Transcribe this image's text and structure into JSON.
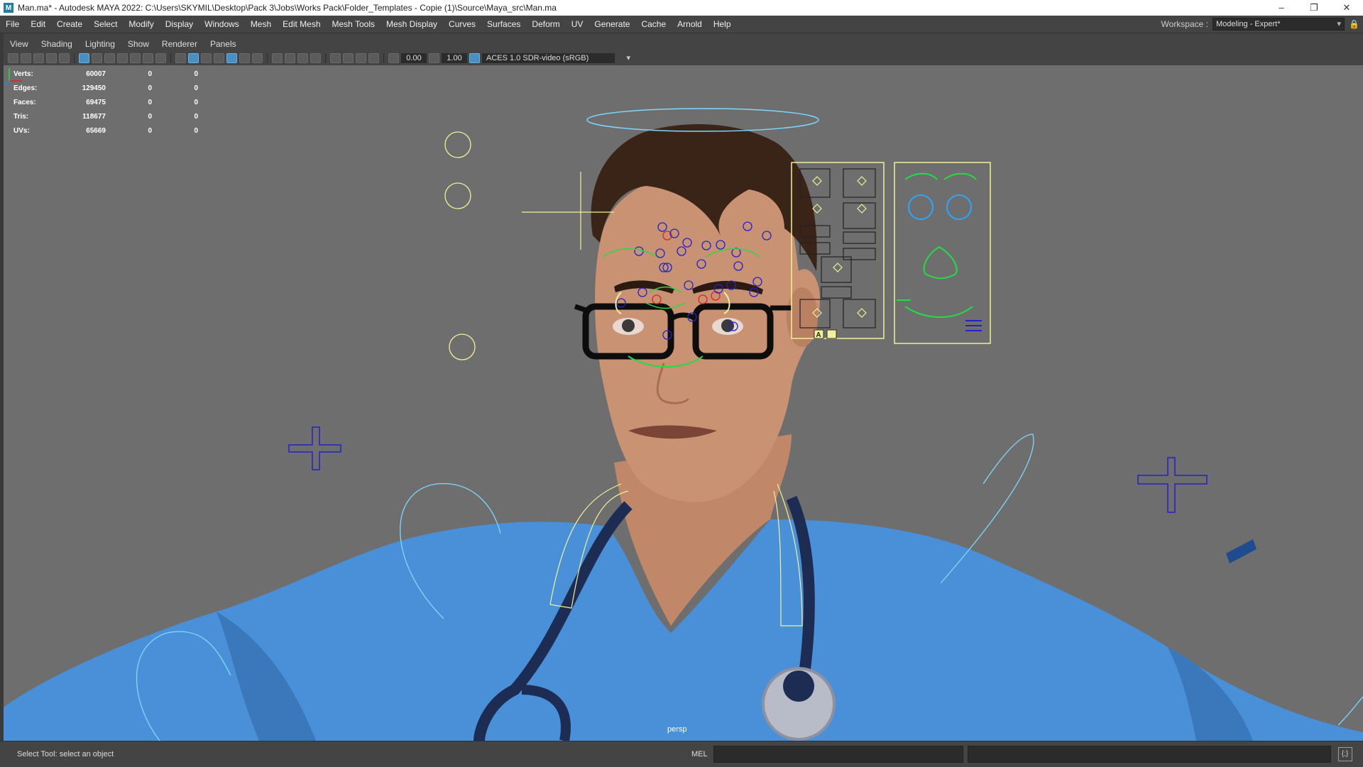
{
  "window": {
    "title": "Man.ma* - Autodesk MAYA 2022: C:\\Users\\SKYMIL\\Desktop\\Pack 3\\Jobs\\Works Pack\\Folder_Templates - Copie (1)\\Source\\Maya_src\\Man.ma",
    "app_icon_letter": "M",
    "minimize": "–",
    "restore": "❐",
    "close": "✕"
  },
  "menubar": {
    "items": [
      "File",
      "Edit",
      "Create",
      "Select",
      "Modify",
      "Display",
      "Windows",
      "Mesh",
      "Edit Mesh",
      "Mesh Tools",
      "Mesh Display",
      "Curves",
      "Surfaces",
      "Deform",
      "UV",
      "Generate",
      "Cache",
      "Arnold",
      "Help"
    ]
  },
  "workspace": {
    "label": "Workspace :",
    "value": "Modeling - Expert*",
    "caret": "▾",
    "lock": "🔒"
  },
  "panel_menu": {
    "items": [
      "View",
      "Shading",
      "Lighting",
      "Show",
      "Renderer",
      "Panels"
    ]
  },
  "panel_toolbar": {
    "exposure": "0.00",
    "gamma": "1.00",
    "color_management": "ACES 1.0 SDR-video (sRGB)",
    "caret": "▾"
  },
  "hud": {
    "rows": [
      {
        "label": "Verts:",
        "v1": "60007",
        "v2": "0",
        "v3": "0"
      },
      {
        "label": "Edges:",
        "v1": "129450",
        "v2": "0",
        "v3": "0"
      },
      {
        "label": "Faces:",
        "v1": "69475",
        "v2": "0",
        "v3": "0"
      },
      {
        "label": "Tris:",
        "v1": "118677",
        "v2": "0",
        "v3": "0"
      },
      {
        "label": "UVs:",
        "v1": "65669",
        "v2": "0",
        "v3": "0"
      }
    ]
  },
  "viewport": {
    "camera_label": "persp",
    "background": "#6e6e6e",
    "rig_colors": {
      "cyan": "#7fd8ff",
      "yellow": "#f1f199",
      "green": "#22dd44",
      "blue": "#2222cc",
      "red": "#dd2222"
    },
    "character_colors": {
      "scrubs": "#4a90d9",
      "skin": "#c99272",
      "hair": "#3a2418",
      "stethoscope": "#1d2c52"
    },
    "facial_panel_labels": [
      "A"
    ]
  },
  "statusbar": {
    "message": "Select Tool: select an object",
    "mel_label": "MEL",
    "script_editor_icon": "{;}"
  }
}
